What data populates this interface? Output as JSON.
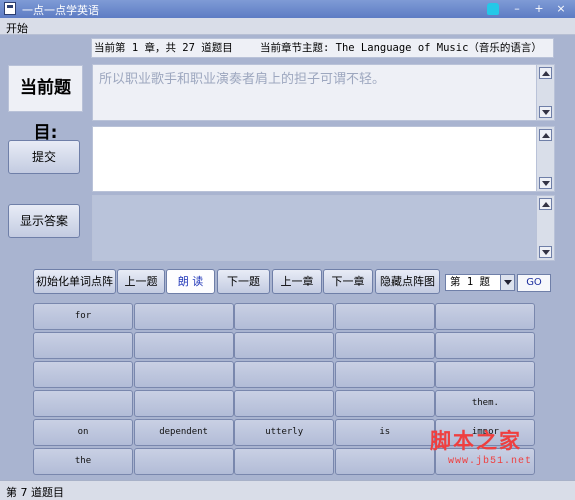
{
  "window": {
    "title": "一点一点学英语"
  },
  "menu": {
    "items": [
      "开始"
    ]
  },
  "info": {
    "progress": "当前第 1 章，共 27 道题目",
    "topic": "当前章节主题: The Language of Music（音乐的语言）"
  },
  "question": {
    "label": "当前题目:",
    "prompt": "所以职业歌手和职业演奏者肩上的担子可谓不轻。",
    "answer_text": "",
    "hint_text": ""
  },
  "buttons": {
    "submit": "提交",
    "show_answer": "显示答案",
    "init_matrix": "初始化单词点阵",
    "prev_question": "上一题",
    "read_aloud": "朗 读",
    "next_question": "下一题",
    "prev_chapter": "上一章",
    "next_chapter": "下一章",
    "hide_matrix": "隐藏点阵图",
    "go": "GO"
  },
  "chapter_select": {
    "value": "第 1 题"
  },
  "word_grid": [
    [
      "for",
      "",
      "",
      "",
      ""
    ],
    [
      "",
      "",
      "",
      "",
      ""
    ],
    [
      "",
      "",
      "",
      "",
      ""
    ],
    [
      "",
      "",
      "",
      "",
      "them."
    ],
    [
      "on",
      "dependent",
      "utterly",
      "is",
      "impor"
    ],
    [
      "the",
      "",
      "",
      "",
      ""
    ]
  ],
  "status": {
    "text": "第 7 道题目"
  },
  "watermark": {
    "main": "脚本之家",
    "sub": "www.jb51.net"
  },
  "colors": {
    "titlebar": "#6a88cc",
    "background": "#a9b4d0",
    "active_text": "#2238b8",
    "watermark": "#ef3f3f"
  }
}
